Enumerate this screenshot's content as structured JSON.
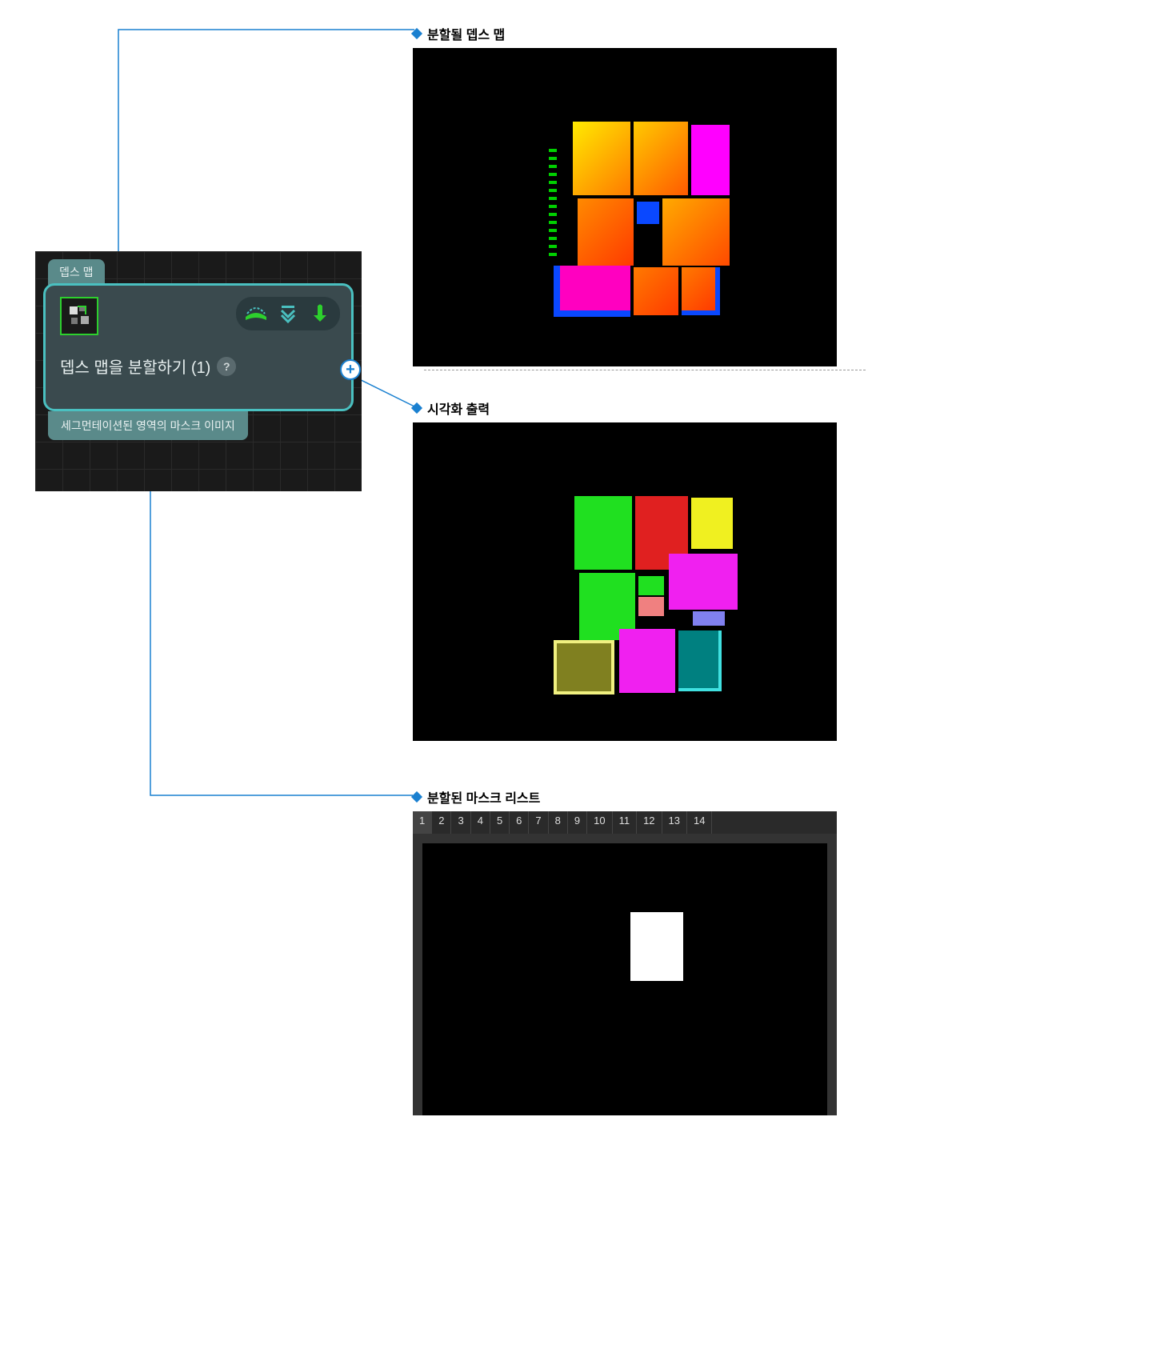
{
  "node": {
    "input_tab": "뎁스 맵",
    "title": "뎁스 맵을 분할하기 (1)",
    "help": "?",
    "add": "+",
    "output_tab": "세그먼테이션된 영역의 마스크 이미지"
  },
  "panels": {
    "depth": {
      "heading": "분할될 뎁스 맵"
    },
    "viz": {
      "heading": "시각화 출력"
    },
    "masks": {
      "heading": "분할된 마스크 리스트",
      "tabs": [
        "1",
        "2",
        "3",
        "4",
        "5",
        "6",
        "7",
        "8",
        "9",
        "10",
        "11",
        "12",
        "13",
        "14"
      ],
      "active_tab": "1"
    }
  }
}
